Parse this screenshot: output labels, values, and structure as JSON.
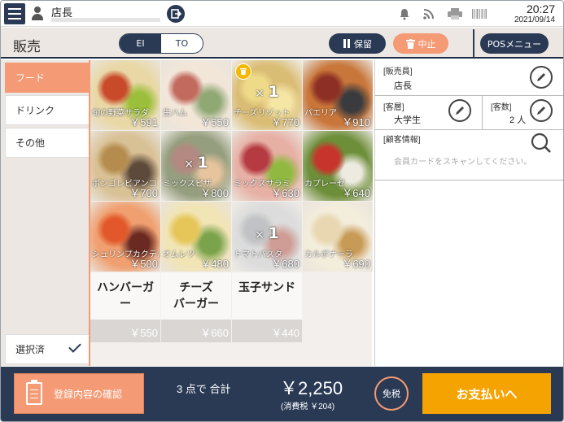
{
  "status_bar": {
    "staff_name": "店長",
    "time": "20:27",
    "date": "2021/09/14",
    "icons": [
      "bell-icon",
      "wifi-icon",
      "printer-icon",
      "barcode-icon",
      "battery-icon"
    ]
  },
  "header": {
    "title": "販売",
    "mode_tabs": [
      {
        "label": "EI",
        "active": true
      },
      {
        "label": "TO",
        "active": false
      }
    ],
    "hold_label": "保留",
    "cancel_label": "中止",
    "pos_menu_label": "POSメニュー"
  },
  "categories": [
    {
      "label": "フード",
      "active": true
    },
    {
      "label": "ドリンク",
      "active": false
    },
    {
      "label": "その他",
      "active": false
    }
  ],
  "selected_filter_label": "選択済",
  "products": [
    {
      "name": "旬の野菜サラダ",
      "price": "￥591",
      "colors": [
        "#c94a2a",
        "#9bbf3a",
        "#e9d8a6"
      ]
    },
    {
      "name": "生ハム",
      "price": "￥550",
      "colors": [
        "#c26a5e",
        "#8fa874",
        "#f2e6d8"
      ]
    },
    {
      "name": "チーズリゾット",
      "price": "￥770",
      "colors": [
        "#e7c64b",
        "#f0d977",
        "#c79a2b"
      ],
      "qty": "1",
      "selected": true
    },
    {
      "name": "パエリア",
      "price": "￥910",
      "colors": [
        "#8d2f24",
        "#3a3b3e",
        "#c9763a"
      ]
    },
    {
      "name": "ボンゴレビアンコ",
      "price": "￥700",
      "colors": [
        "#b58c4d",
        "#5d4a3a",
        "#d9c196"
      ]
    },
    {
      "name": "ミックスピザ",
      "price": "￥800",
      "colors": [
        "#8a4a3e",
        "#d7a56b",
        "#5d6b3a"
      ],
      "qty": "1",
      "dim": true
    },
    {
      "name": "ミックスサラミ",
      "price": "￥630",
      "colors": [
        "#b53a42",
        "#8fba3f",
        "#e7b0a5"
      ]
    },
    {
      "name": "カプレーゼ",
      "price": "￥640",
      "colors": [
        "#c7342b",
        "#edeae0",
        "#6e8f3a"
      ]
    },
    {
      "name": "シュリンプカクテル",
      "price": "￥500",
      "colors": [
        "#e2582b",
        "#6a2a22",
        "#f0a070"
      ]
    },
    {
      "name": "オムレツ",
      "price": "￥480",
      "colors": [
        "#e6c658",
        "#7aa34b",
        "#f1e4b5"
      ]
    },
    {
      "name": "トマトパスタ",
      "price": "￥680",
      "colors": [
        "#9fa2a6",
        "#b5695c",
        "#c9c9c9"
      ],
      "qty": "1",
      "dim": true
    },
    {
      "name": "カルボナーラ",
      "price": "￥690",
      "colors": [
        "#e8d7b0",
        "#c79a56",
        "#f3eddc"
      ]
    }
  ],
  "text_products": [
    {
      "name_line1": "ハンバーガ",
      "name_line2": "ー",
      "price": "￥550"
    },
    {
      "name_line1": "チーズ",
      "name_line2": "バーガー",
      "price": "￥660"
    },
    {
      "name_line1": "玉子サンド",
      "name_line2": "",
      "price": "￥440"
    }
  ],
  "customer": {
    "salesperson_label": "[販売員]",
    "salesperson_value": "店長",
    "segment_label": "[客層]",
    "segment_value": "大学生",
    "count_label": "[客数]",
    "count_value": "2 人",
    "info_label": "[顧客情報]",
    "member_hint": "会員カードをスキャンしてください。"
  },
  "footer": {
    "confirm_label": "登録内容の確認",
    "count_summary": "3 点で 合計",
    "total": "￥2,250",
    "tax": "(消費税 ￥204)",
    "tax_free_label": "免税",
    "pay_label": "お支払いへ"
  },
  "theme": {
    "navy": "#2a3a55",
    "accent": "#f49a74",
    "pay": "#f5a300",
    "bg": "#ece7e2"
  }
}
